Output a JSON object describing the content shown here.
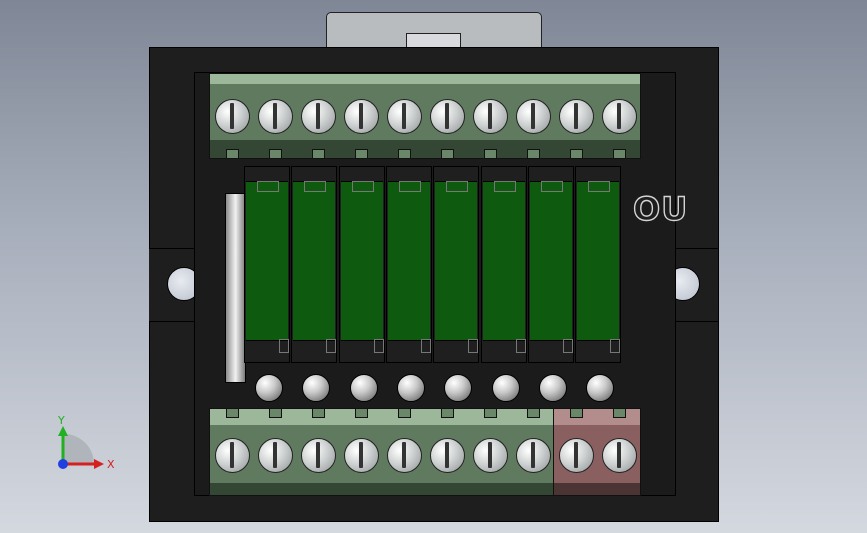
{
  "viewport": {
    "background": "#a9b0bd"
  },
  "module": {
    "label": "OU",
    "top_terminal_count": 10,
    "bottom_green_terminal_count": 8,
    "bottom_red_terminal_count": 2,
    "relay_count": 8,
    "led_count": 8,
    "colors": {
      "housing": "#1e1e1e",
      "terminal_green": "#5f7a5f",
      "terminal_red": "#8a5f5f",
      "relay_green": "#0e5a0e",
      "clip": "#b9bcbf"
    }
  },
  "triad": {
    "x_label": "X",
    "y_label": "Y",
    "colors": {
      "x": "#d42020",
      "y": "#20b020",
      "z": "#2040e0"
    }
  }
}
